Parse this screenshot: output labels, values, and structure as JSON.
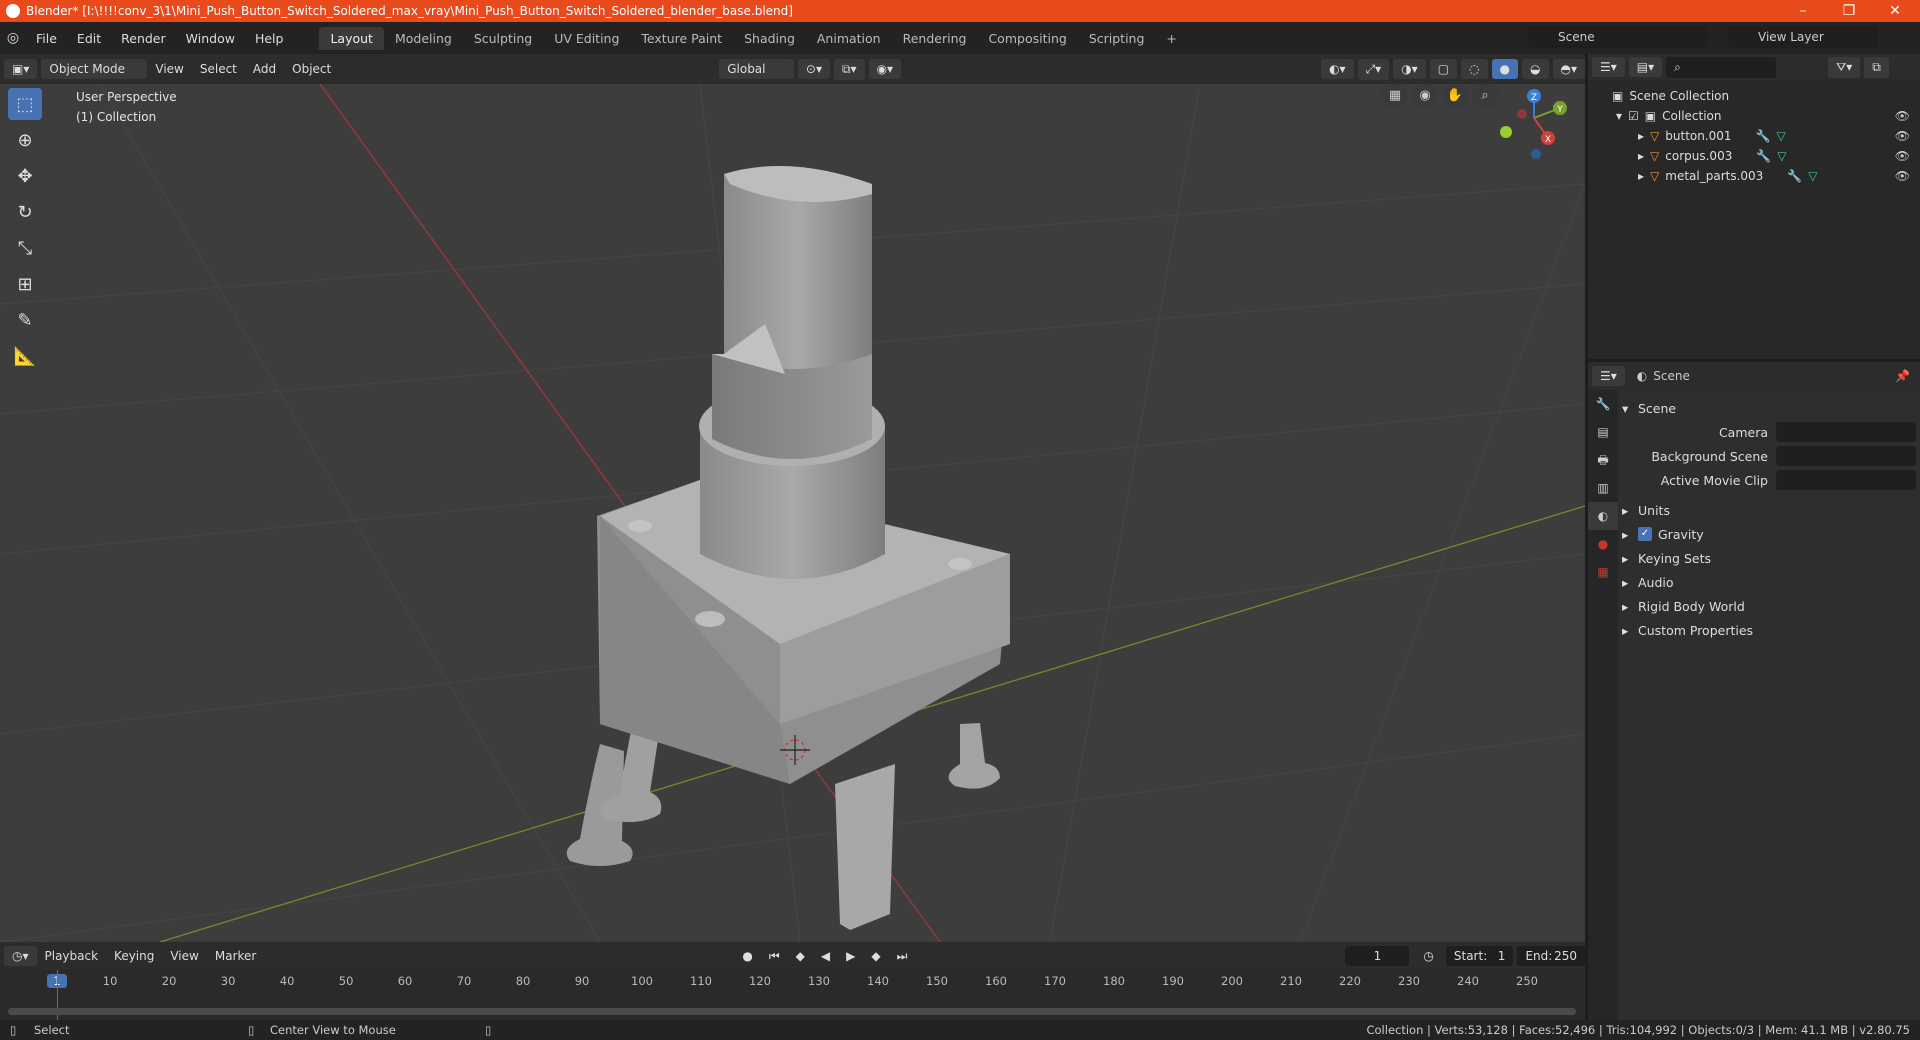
{
  "window": {
    "title": "Blender* [I:\\!!!!conv_3\\1\\Mini_Push_Button_Switch_Soldered_max_vray\\Mini_Push_Button_Switch_Soldered_blender_base.blend]",
    "minimize": "–",
    "maximize": "❐",
    "close": "✕"
  },
  "menu": {
    "file": "File",
    "edit": "Edit",
    "render": "Render",
    "window": "Window",
    "help": "Help"
  },
  "workspaces": [
    "Layout",
    "Modeling",
    "Sculpting",
    "UV Editing",
    "Texture Paint",
    "Shading",
    "Animation",
    "Rendering",
    "Compositing",
    "Scripting"
  ],
  "add_workspace": "+",
  "scene_field": "Scene",
  "view_layer_field": "View Layer",
  "header3d": {
    "mode": "Object Mode",
    "view": "View",
    "select": "Select",
    "add": "Add",
    "object": "Object",
    "orientation": "Global"
  },
  "viewport": {
    "perspective": "User Perspective",
    "collection": "(1) Collection",
    "gizmo": {
      "x": "X",
      "y": "Y",
      "z": "Z"
    }
  },
  "outliner": {
    "root": "Scene Collection",
    "collection": "Collection",
    "objects": [
      "button.001",
      "corpus.003",
      "metal_parts.003"
    ]
  },
  "properties": {
    "context": "Scene",
    "panel": "Scene",
    "camera": "Camera",
    "background_scene": "Background Scene",
    "active_movie_clip": "Active Movie Clip",
    "sections": [
      "Units",
      "Gravity",
      "Keying Sets",
      "Audio",
      "Rigid Body World",
      "Custom Properties"
    ],
    "gravity_checked": true
  },
  "timeline": {
    "playback": "Playback",
    "keying": "Keying",
    "view": "View",
    "marker": "Marker",
    "current_frame": "1",
    "start_label": "Start:",
    "start": "1",
    "end_label": "End:",
    "end": "250",
    "ticks": [
      "1",
      "10",
      "20",
      "30",
      "40",
      "50",
      "60",
      "70",
      "80",
      "90",
      "100",
      "110",
      "120",
      "130",
      "140",
      "150",
      "160",
      "170",
      "180",
      "190",
      "200",
      "210",
      "220",
      "230",
      "240",
      "250"
    ]
  },
  "status": {
    "select": "Select",
    "center_view": "Center View to Mouse",
    "stats": "Collection | Verts:53,128 | Faces:52,496 | Tris:104,992 | Objects:0/3 | Mem: 41.1 MB | v2.80.75"
  },
  "colors": {
    "title_bar": "#e84a1c",
    "accent": "#4772b3",
    "x_axis": "#d0413c",
    "y_axis": "#7ba12e",
    "z_axis": "#3b7fd6"
  }
}
